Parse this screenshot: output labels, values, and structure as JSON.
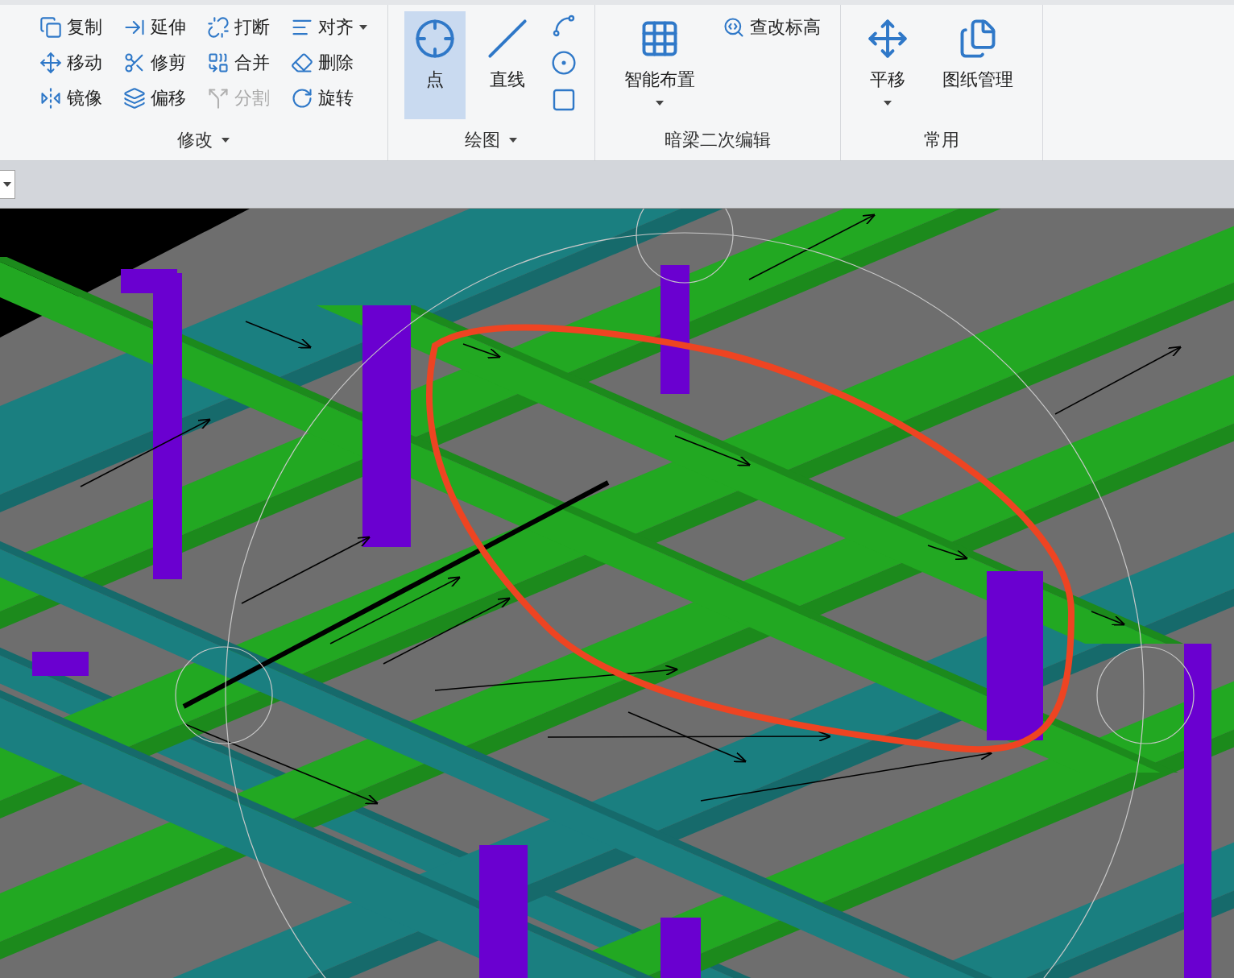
{
  "ribbon": {
    "groups": [
      {
        "label": "修改",
        "menu": true,
        "tools": [
          {
            "label": "复制",
            "kind": "small",
            "selected": false,
            "disabled": false,
            "menu": false
          },
          {
            "label": "移动",
            "kind": "small",
            "selected": false,
            "disabled": false,
            "menu": false
          },
          {
            "label": "镜像",
            "kind": "small",
            "selected": false,
            "disabled": false,
            "menu": false
          },
          {
            "label": "延伸",
            "kind": "small",
            "selected": false,
            "disabled": false,
            "menu": false
          },
          {
            "label": "修剪",
            "kind": "small",
            "selected": false,
            "disabled": false,
            "menu": false
          },
          {
            "label": "偏移",
            "kind": "small",
            "selected": false,
            "disabled": false,
            "menu": false
          },
          {
            "label": "打断",
            "kind": "small",
            "selected": false,
            "disabled": false,
            "menu": false
          },
          {
            "label": "合并",
            "kind": "small",
            "selected": false,
            "disabled": false,
            "menu": false
          },
          {
            "label": "分割",
            "kind": "small",
            "selected": false,
            "disabled": true,
            "menu": false
          },
          {
            "label": "对齐",
            "kind": "small",
            "selected": false,
            "disabled": false,
            "menu": true
          },
          {
            "label": "删除",
            "kind": "small",
            "selected": false,
            "disabled": false,
            "menu": false
          },
          {
            "label": "旋转",
            "kind": "small",
            "selected": false,
            "disabled": false,
            "menu": false
          }
        ]
      },
      {
        "label": "绘图",
        "menu": true,
        "tools": [
          {
            "label": "点",
            "kind": "large",
            "selected": true,
            "disabled": false,
            "menu": false
          },
          {
            "label": "直线",
            "kind": "large",
            "selected": false,
            "disabled": false,
            "menu": false
          },
          {
            "kind": "icon",
            "selected": false,
            "disabled": false,
            "menu": false
          },
          {
            "kind": "icon",
            "selected": false,
            "disabled": false,
            "menu": false
          },
          {
            "kind": "icon",
            "selected": false,
            "disabled": false,
            "menu": false
          }
        ]
      },
      {
        "label": "暗梁二次编辑",
        "menu": false,
        "tools": [
          {
            "label": "智能布置",
            "kind": "large",
            "selected": false,
            "disabled": false,
            "menu": true
          },
          {
            "label": "查改标高",
            "kind": "small",
            "selected": false,
            "disabled": false,
            "menu": false
          }
        ]
      },
      {
        "label": "常用",
        "menu": false,
        "tools": [
          {
            "label": "平移",
            "kind": "large",
            "selected": false,
            "disabled": false,
            "menu": true
          },
          {
            "label": "图纸管理",
            "kind": "large",
            "selected": false,
            "disabled": false,
            "menu": false
          }
        ]
      }
    ]
  }
}
